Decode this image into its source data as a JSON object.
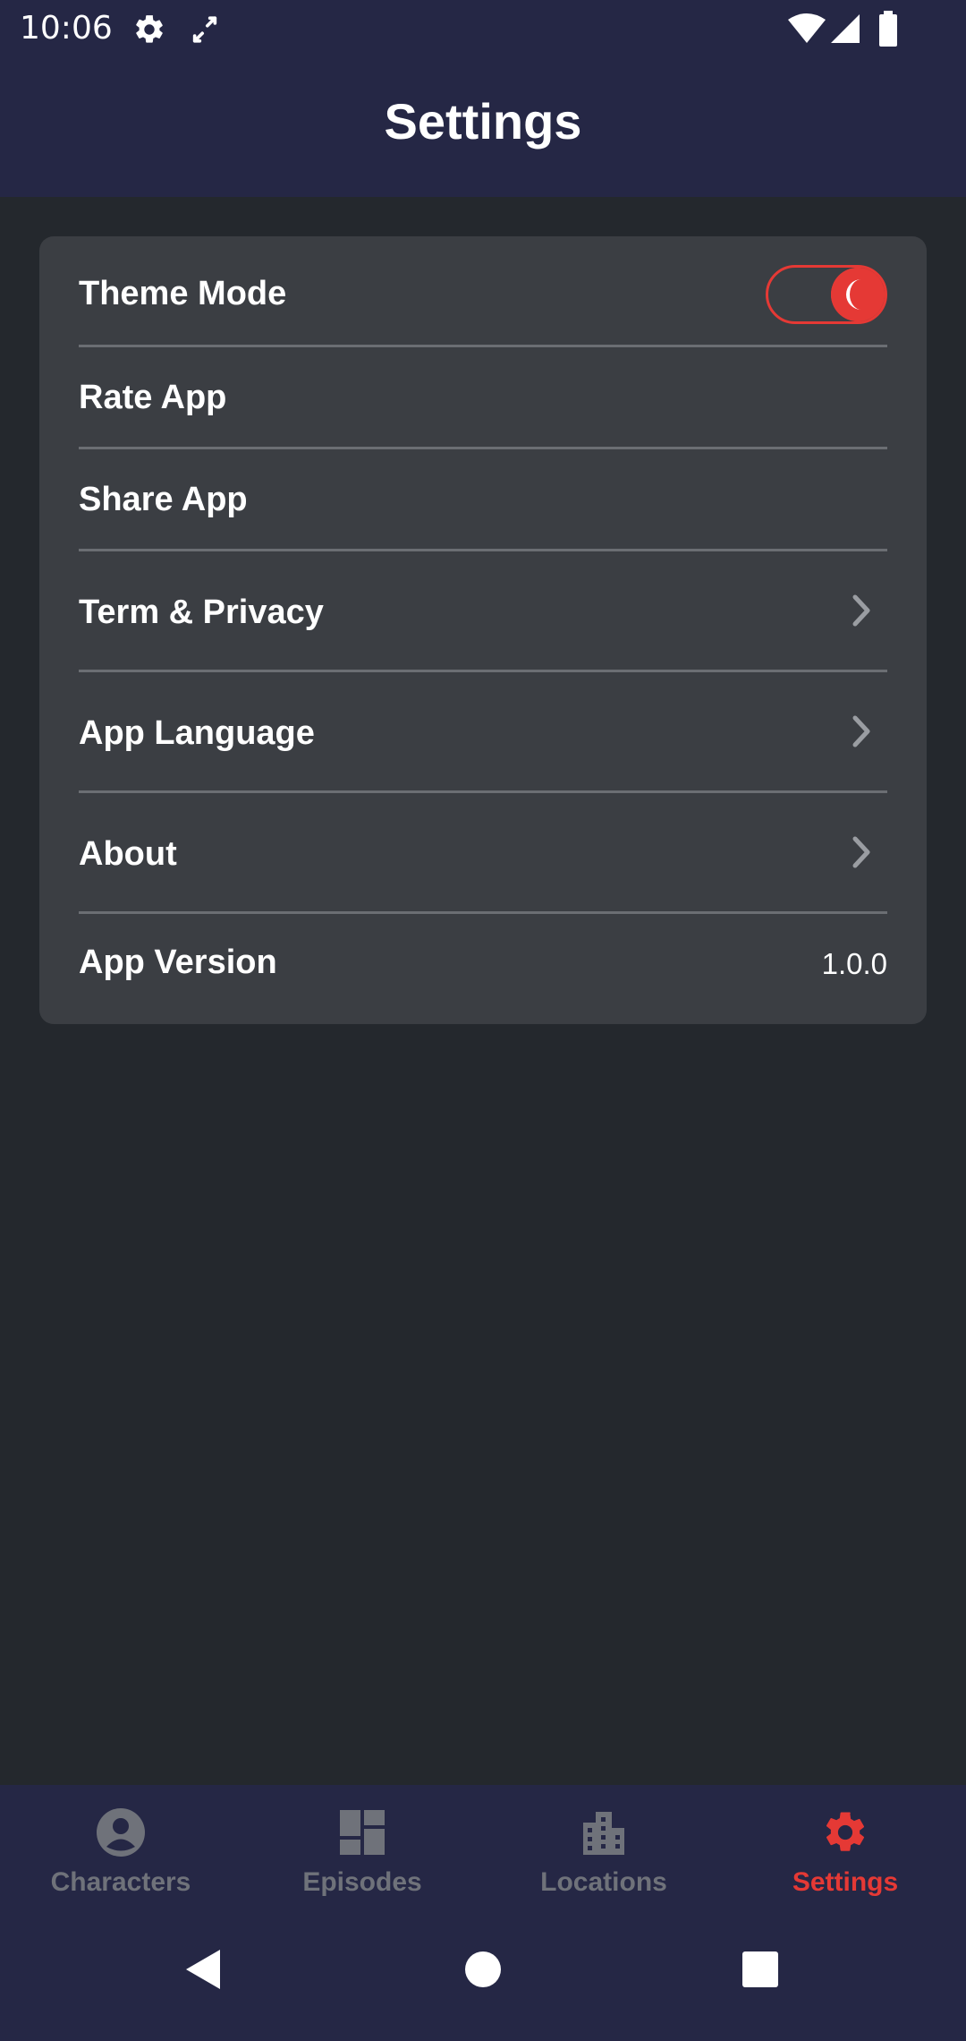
{
  "status_bar": {
    "time": "10:06",
    "icons": [
      "gear-icon",
      "screen-rotate-icon",
      "wifi-icon",
      "signal-icon",
      "battery-icon"
    ]
  },
  "app_bar": {
    "title": "Settings"
  },
  "settings": {
    "rows": [
      {
        "label": "Theme Mode",
        "control": "toggle",
        "toggle_on": true
      },
      {
        "label": "Rate App"
      },
      {
        "label": "Share App"
      },
      {
        "label": "Term & Privacy",
        "icon": "chevron-right-icon"
      },
      {
        "label": "App Language",
        "icon": "chevron-right-icon"
      },
      {
        "label": "About",
        "icon": "chevron-right-icon"
      },
      {
        "label": "App Version",
        "value": "1.0.0"
      }
    ]
  },
  "bottom_nav": {
    "items": [
      {
        "label": "Characters",
        "icon": "person-circle-icon",
        "active": false
      },
      {
        "label": "Episodes",
        "icon": "dashboard-icon",
        "active": false
      },
      {
        "label": "Locations",
        "icon": "buildings-icon",
        "active": false
      },
      {
        "label": "Settings",
        "icon": "gear-icon",
        "active": true
      }
    ]
  },
  "system_nav": {
    "buttons": [
      "back-icon",
      "home-icon",
      "recents-icon"
    ]
  },
  "colors": {
    "background": "#24282d",
    "bar": "#252745",
    "card": "#3b3e43",
    "accent": "#e53935",
    "inactive": "#6f727a",
    "divider": "#6b6e73"
  }
}
